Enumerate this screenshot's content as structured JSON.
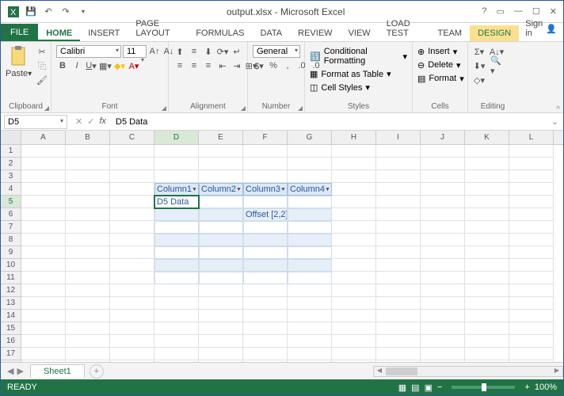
{
  "title": "output.xlsx - Microsoft Excel",
  "tabs": [
    "FILE",
    "HOME",
    "INSERT",
    "PAGE LAYOUT",
    "FORMULAS",
    "DATA",
    "REVIEW",
    "VIEW",
    "LOAD TEST",
    "TEAM",
    "DESIGN"
  ],
  "signin": "Sign in",
  "ribbon": {
    "clipboard": {
      "paste": "Paste",
      "label": "Clipboard"
    },
    "font": {
      "name": "Calibri",
      "size": "11",
      "label": "Font"
    },
    "alignment": {
      "label": "Alignment"
    },
    "number": {
      "format": "General",
      "label": "Number"
    },
    "styles": {
      "cf": "Conditional Formatting",
      "fat": "Format as Table",
      "cs": "Cell Styles",
      "label": "Styles"
    },
    "cells": {
      "ins": "Insert",
      "del": "Delete",
      "fmt": "Format",
      "label": "Cells"
    },
    "editing": {
      "label": "Editing"
    }
  },
  "namebox": "D5",
  "formula": "D5 Data",
  "columns": [
    "A",
    "B",
    "C",
    "D",
    "E",
    "F",
    "G",
    "H",
    "I",
    "J",
    "K",
    "L"
  ],
  "table": {
    "headers": [
      "Column1",
      "Column2",
      "Column3",
      "Column4"
    ],
    "d5": "D5 Data",
    "f6": "Offset [2,2]"
  },
  "sheet_tab": "Sheet1",
  "status": "READY",
  "zoom": "100%"
}
